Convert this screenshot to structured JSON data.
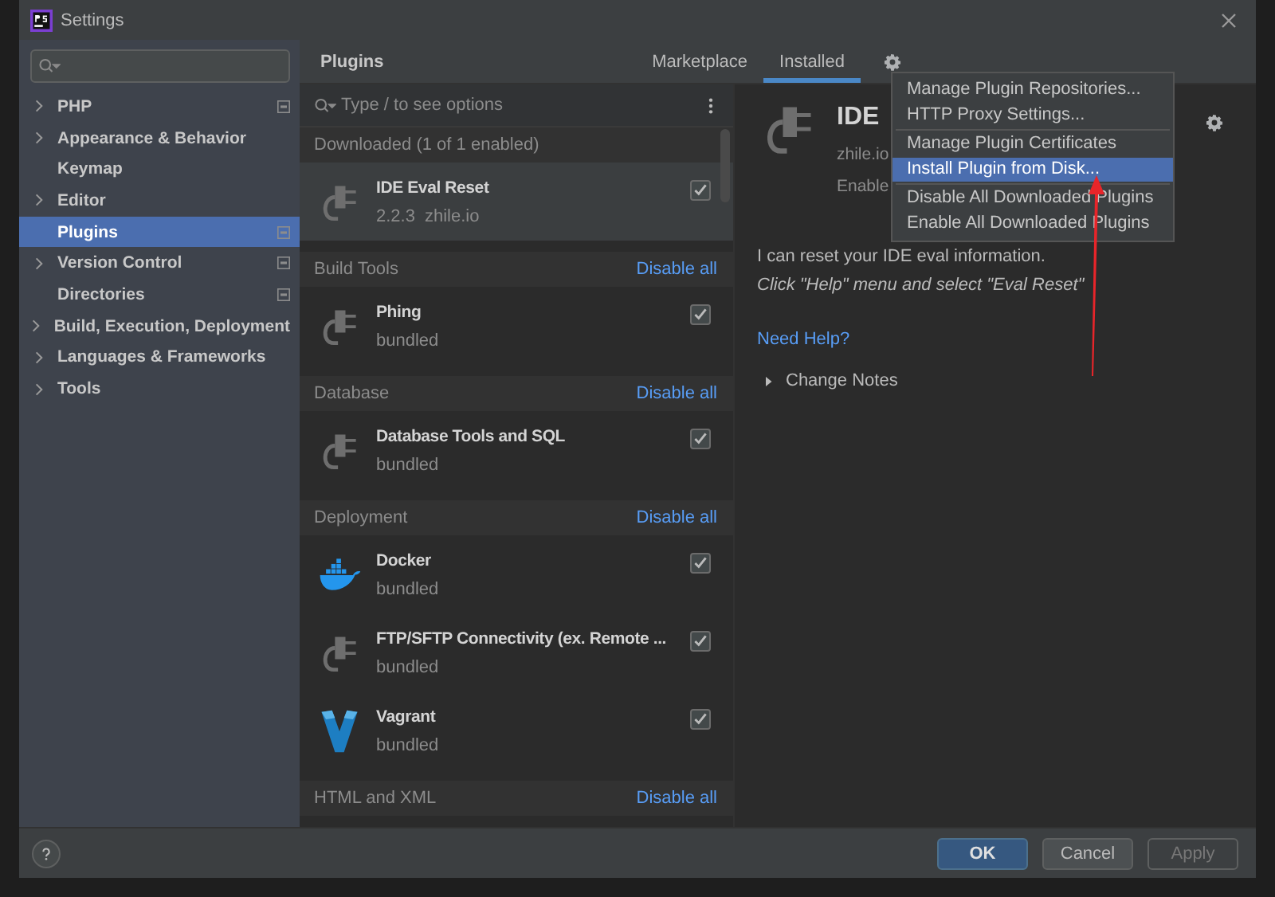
{
  "window": {
    "title": "Settings"
  },
  "sidebar": {
    "items": [
      {
        "label": "PHP",
        "kind": "folder",
        "project_level": true,
        "selected": false
      },
      {
        "label": "Appearance & Behavior",
        "kind": "folder",
        "project_level": false,
        "selected": false
      },
      {
        "label": "Keymap",
        "kind": "page",
        "project_level": false,
        "selected": false
      },
      {
        "label": "Editor",
        "kind": "folder",
        "project_level": false,
        "selected": false
      },
      {
        "label": "Plugins",
        "kind": "page",
        "project_level": true,
        "selected": true
      },
      {
        "label": "Version Control",
        "kind": "folder",
        "project_level": true,
        "selected": false
      },
      {
        "label": "Directories",
        "kind": "page",
        "project_level": true,
        "selected": false
      },
      {
        "label": "Build, Execution, Deployment",
        "kind": "folder",
        "project_level": false,
        "selected": false
      },
      {
        "label": "Languages & Frameworks",
        "kind": "folder",
        "project_level": false,
        "selected": false
      },
      {
        "label": "Tools",
        "kind": "folder",
        "project_level": false,
        "selected": false
      }
    ]
  },
  "header": {
    "title": "Plugins",
    "tabs": [
      {
        "label": "Marketplace",
        "selected": false
      },
      {
        "label": "Installed",
        "selected": true
      }
    ]
  },
  "plugin_list": {
    "search": {
      "placeholder": "Type / to see options"
    },
    "groups": [
      {
        "title": "Downloaded (1 of 1 enabled)",
        "items": [
          {
            "name": "IDE Eval Reset",
            "version": "2.2.3",
            "vendor": "zhile.io",
            "kind": "plug",
            "checked": true,
            "selected": true
          }
        ]
      },
      {
        "title": "Build Tools",
        "action": "Disable all",
        "items": [
          {
            "name": "Phing",
            "vendor": "bundled",
            "kind": "plug",
            "checked": true,
            "selected": false
          }
        ]
      },
      {
        "title": "Database",
        "action": "Disable all",
        "items": [
          {
            "name": "Database Tools and SQL",
            "vendor": "bundled",
            "kind": "plug",
            "checked": true,
            "selected": false
          }
        ]
      },
      {
        "title": "Deployment",
        "action": "Disable all",
        "items": [
          {
            "name": "Docker",
            "vendor": "bundled",
            "kind": "docker",
            "checked": true,
            "selected": false
          },
          {
            "name": "FTP/SFTP Connectivity (ex. Remote ...",
            "vendor": "bundled",
            "kind": "plug",
            "checked": true,
            "selected": false
          },
          {
            "name": "Vagrant",
            "vendor": "bundled",
            "kind": "vagrant",
            "checked": true,
            "selected": false
          }
        ]
      },
      {
        "title": "HTML and XML",
        "action": "Disable all"
      }
    ]
  },
  "detail": {
    "title": "IDE",
    "vendor": "zhile.io",
    "status": "Enable",
    "description": "I can reset your IDE eval information.",
    "hint": "Click \"Help\" menu and select \"Eval Reset\"",
    "link": "Need Help?",
    "section": {
      "label": "Change Notes",
      "expanded": false
    }
  },
  "menu": {
    "groups": [
      [
        {
          "label": "Manage Plugin Repositories...",
          "selected": false
        },
        {
          "label": "HTTP Proxy Settings...",
          "selected": false
        }
      ],
      [
        {
          "label": "Manage Plugin Certificates",
          "selected": false
        },
        {
          "label": "Install Plugin from Disk...",
          "selected": true
        }
      ],
      [
        {
          "label": "Disable All Downloaded Plugins",
          "selected": false
        },
        {
          "label": "Enable All Downloaded Plugins",
          "selected": false
        }
      ]
    ]
  },
  "buttons": [
    {
      "label": "OK",
      "kind": "primary",
      "disabled": false
    },
    {
      "label": "Cancel",
      "kind": "normal",
      "disabled": false
    },
    {
      "label": "Apply",
      "kind": "normal",
      "disabled": true
    }
  ]
}
